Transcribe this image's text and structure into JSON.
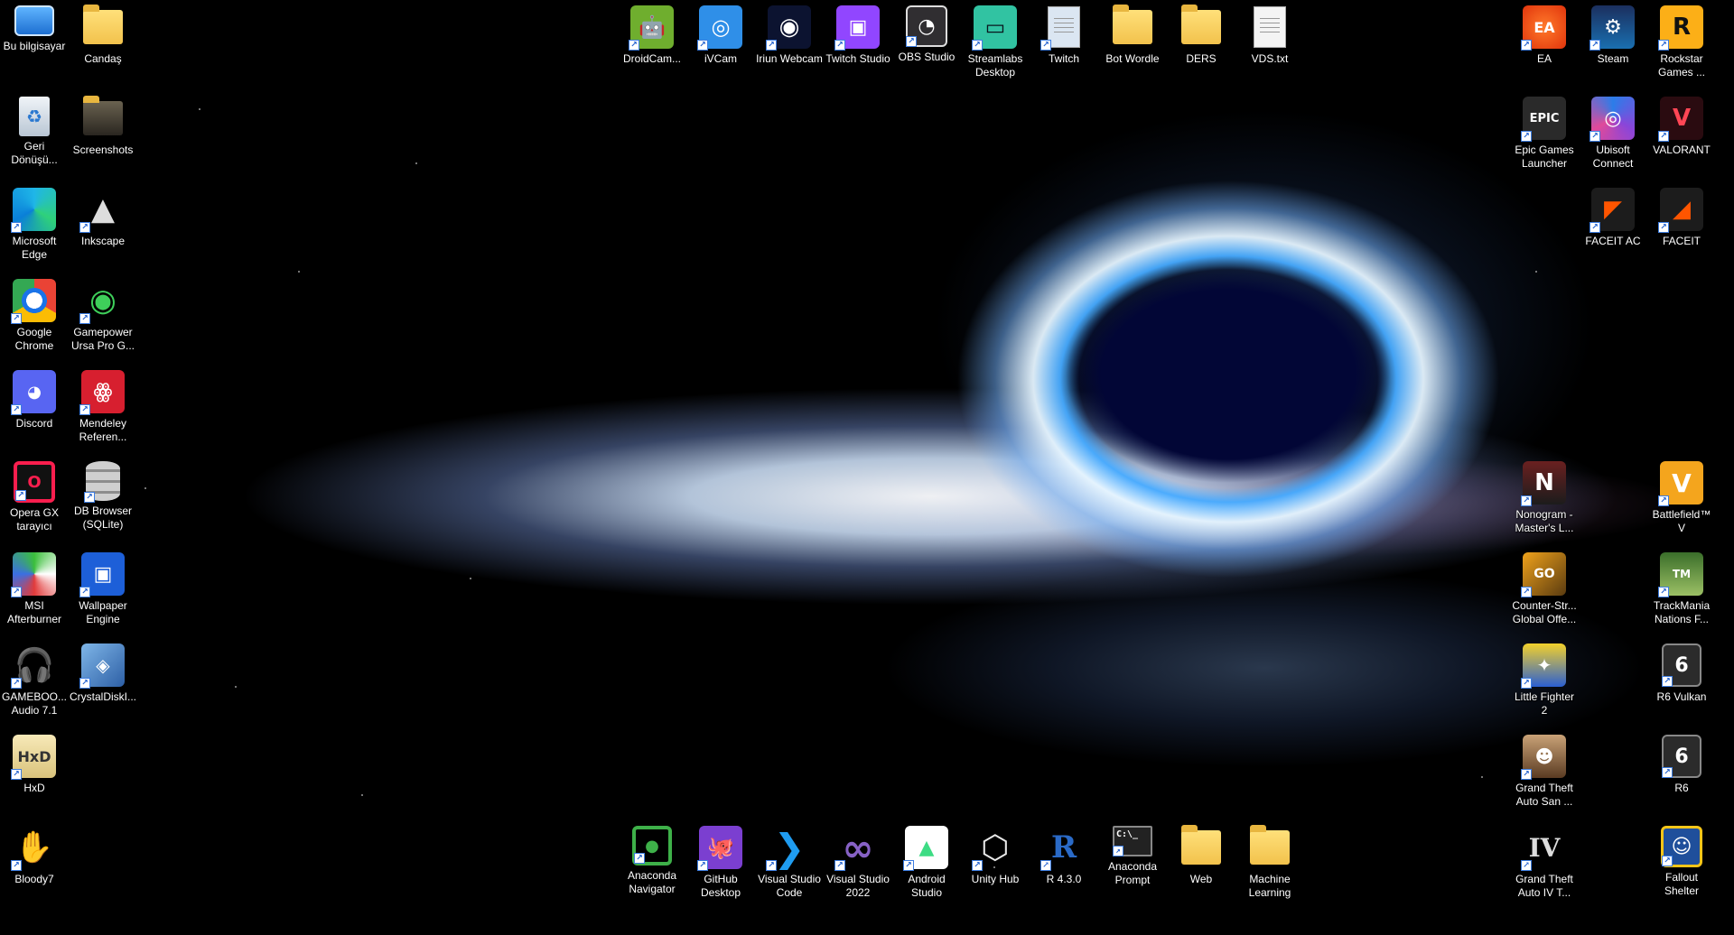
{
  "desktop": {
    "left_col1": [
      {
        "label": "Bu bilgisayar",
        "icon": "computer-icon"
      },
      {
        "label": "Geri Dönüşü...",
        "icon": "recycle-bin-icon"
      },
      {
        "label": "Microsoft Edge",
        "icon": "edge-icon"
      },
      {
        "label": "Google Chrome",
        "icon": "chrome-icon"
      },
      {
        "label": "Discord",
        "icon": "discord-icon"
      },
      {
        "label": "Opera GX tarayıcı",
        "icon": "opera-gx-icon"
      },
      {
        "label": "MSI Afterburner",
        "icon": "msi-afterburner-icon"
      },
      {
        "label": "GAMEBOO... Audio 7.1",
        "icon": "headset-icon"
      },
      {
        "label": "HxD",
        "icon": "hxd-icon"
      },
      {
        "label": "Bloody7",
        "icon": "bloody-icon"
      }
    ],
    "left_col2": [
      {
        "label": "Candaş",
        "icon": "user-folder-icon"
      },
      {
        "label": "Screenshots",
        "icon": "folder-icon"
      },
      {
        "label": "Inkscape",
        "icon": "inkscape-icon"
      },
      {
        "label": "Gamepower Ursa Pro G...",
        "icon": "gamepower-icon"
      },
      {
        "label": "Mendeley Referen...",
        "icon": "mendeley-icon"
      },
      {
        "label": "DB Browser (SQLite)",
        "icon": "database-icon"
      },
      {
        "label": "Wallpaper Engine",
        "icon": "wallpaper-engine-icon"
      },
      {
        "label": "CrystalDiskI...",
        "icon": "crystaldisk-icon"
      }
    ],
    "top_row": [
      {
        "label": "DroidCam...",
        "icon": "droidcam-icon"
      },
      {
        "label": "iVCam",
        "icon": "ivcam-icon"
      },
      {
        "label": "Iriun Webcam",
        "icon": "webcam-icon"
      },
      {
        "label": "Twitch Studio",
        "icon": "twitch-studio-icon"
      },
      {
        "label": "OBS Studio",
        "icon": "obs-icon"
      },
      {
        "label": "Streamlabs Desktop",
        "icon": "streamlabs-icon"
      },
      {
        "label": "Twitch",
        "icon": "twitch-icon"
      },
      {
        "label": "Bot Wordle",
        "icon": "folder-icon"
      },
      {
        "label": "DERS",
        "icon": "folder-icon"
      },
      {
        "label": "VDS.txt",
        "icon": "text-file-icon"
      }
    ],
    "bottom_row": [
      {
        "label": "Anaconda Navigator",
        "icon": "anaconda-icon"
      },
      {
        "label": "GitHub Desktop",
        "icon": "github-icon"
      },
      {
        "label": "Visual Studio Code",
        "icon": "vscode-icon"
      },
      {
        "label": "Visual Studio 2022",
        "icon": "visual-studio-icon"
      },
      {
        "label": "Android Studio",
        "icon": "android-studio-icon"
      },
      {
        "label": "Unity Hub",
        "icon": "unity-icon"
      },
      {
        "label": "R 4.3.0",
        "icon": "r-icon"
      },
      {
        "label": "Anaconda Prompt",
        "icon": "terminal-icon"
      },
      {
        "label": "Web",
        "icon": "folder-icon"
      },
      {
        "label": "Machine Learning",
        "icon": "folder-icon"
      }
    ],
    "right_col1": [
      {
        "label": "EA",
        "icon": "ea-icon"
      },
      {
        "label": "Epic Games Launcher",
        "icon": "epic-games-icon"
      },
      {
        "label": "Nonogram - Master's L...",
        "icon": "nonogram-icon"
      },
      {
        "label": "Counter-Str... Global Offe...",
        "icon": "csgo-icon"
      },
      {
        "label": "Little Fighter 2",
        "icon": "little-fighter-icon"
      },
      {
        "label": "Grand Theft Auto San ...",
        "icon": "gta-sa-icon"
      },
      {
        "label": "Grand Theft Auto IV T...",
        "icon": "gta-iv-icon"
      }
    ],
    "right_col2": [
      {
        "label": "Steam",
        "icon": "steam-icon"
      },
      {
        "label": "Ubisoft Connect",
        "icon": "ubisoft-icon"
      },
      {
        "label": "FACEIT AC",
        "icon": "faceit-ac-icon"
      }
    ],
    "right_col3": [
      {
        "label": "Rockstar Games ...",
        "icon": "rockstar-icon"
      },
      {
        "label": "VALORANT",
        "icon": "valorant-icon"
      },
      {
        "label": "FACEIT",
        "icon": "faceit-icon"
      },
      {
        "label": "Battlefield™ V",
        "icon": "battlefield-icon"
      },
      {
        "label": "TrackMania Nations F...",
        "icon": "trackmania-icon"
      },
      {
        "label": "R6 Vulkan",
        "icon": "r6-icon"
      },
      {
        "label": "R6",
        "icon": "r6-icon"
      },
      {
        "label": "Fallout Shelter",
        "icon": "fallout-icon"
      }
    ]
  }
}
